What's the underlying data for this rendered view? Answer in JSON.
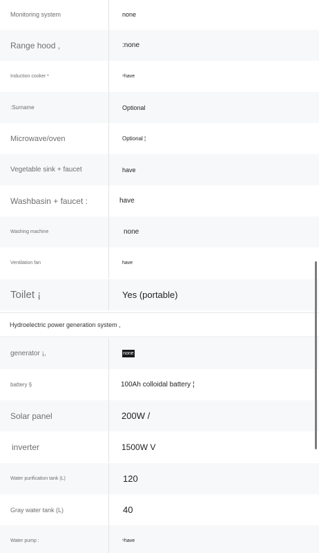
{
  "rows": [
    {
      "label": "Monitoring system",
      "value": "none"
    },
    {
      "label": "Range hood ,",
      "value": ":none"
    },
    {
      "label": "Induction cooker ¹",
      "value": "⁹have"
    },
    {
      "label": ":Surname",
      "value": "Optional"
    },
    {
      "label": "Microwave/oven",
      "value": "Optional ¦"
    },
    {
      "label": "Vegetable sink + faucet",
      "value": "have"
    },
    {
      "label": "Washbasin + faucet :",
      "value": "have"
    },
    {
      "label": "Washing machine",
      "value": "none"
    },
    {
      "label": "Ventilation fan",
      "value": "have"
    },
    {
      "label": "Toilet  ¡",
      "value": "Yes (portable)"
    }
  ],
  "section_title": "Hydroelectric power generation system ,",
  "power_rows": [
    {
      "label": "generator ¡,",
      "value": "none"
    },
    {
      "label": "battery §",
      "value": "100Ah colloidal battery ¦"
    },
    {
      "label": "Solar panel",
      "value": "200W /"
    },
    {
      "label": "inverter",
      "value": "1500W V"
    },
    {
      "label": "Water purification tank (L)",
      "value": "120"
    },
    {
      "label": "Gray water tank (L)",
      "value": "40"
    },
    {
      "label": "Water pump :",
      "value": "⁹have"
    }
  ]
}
